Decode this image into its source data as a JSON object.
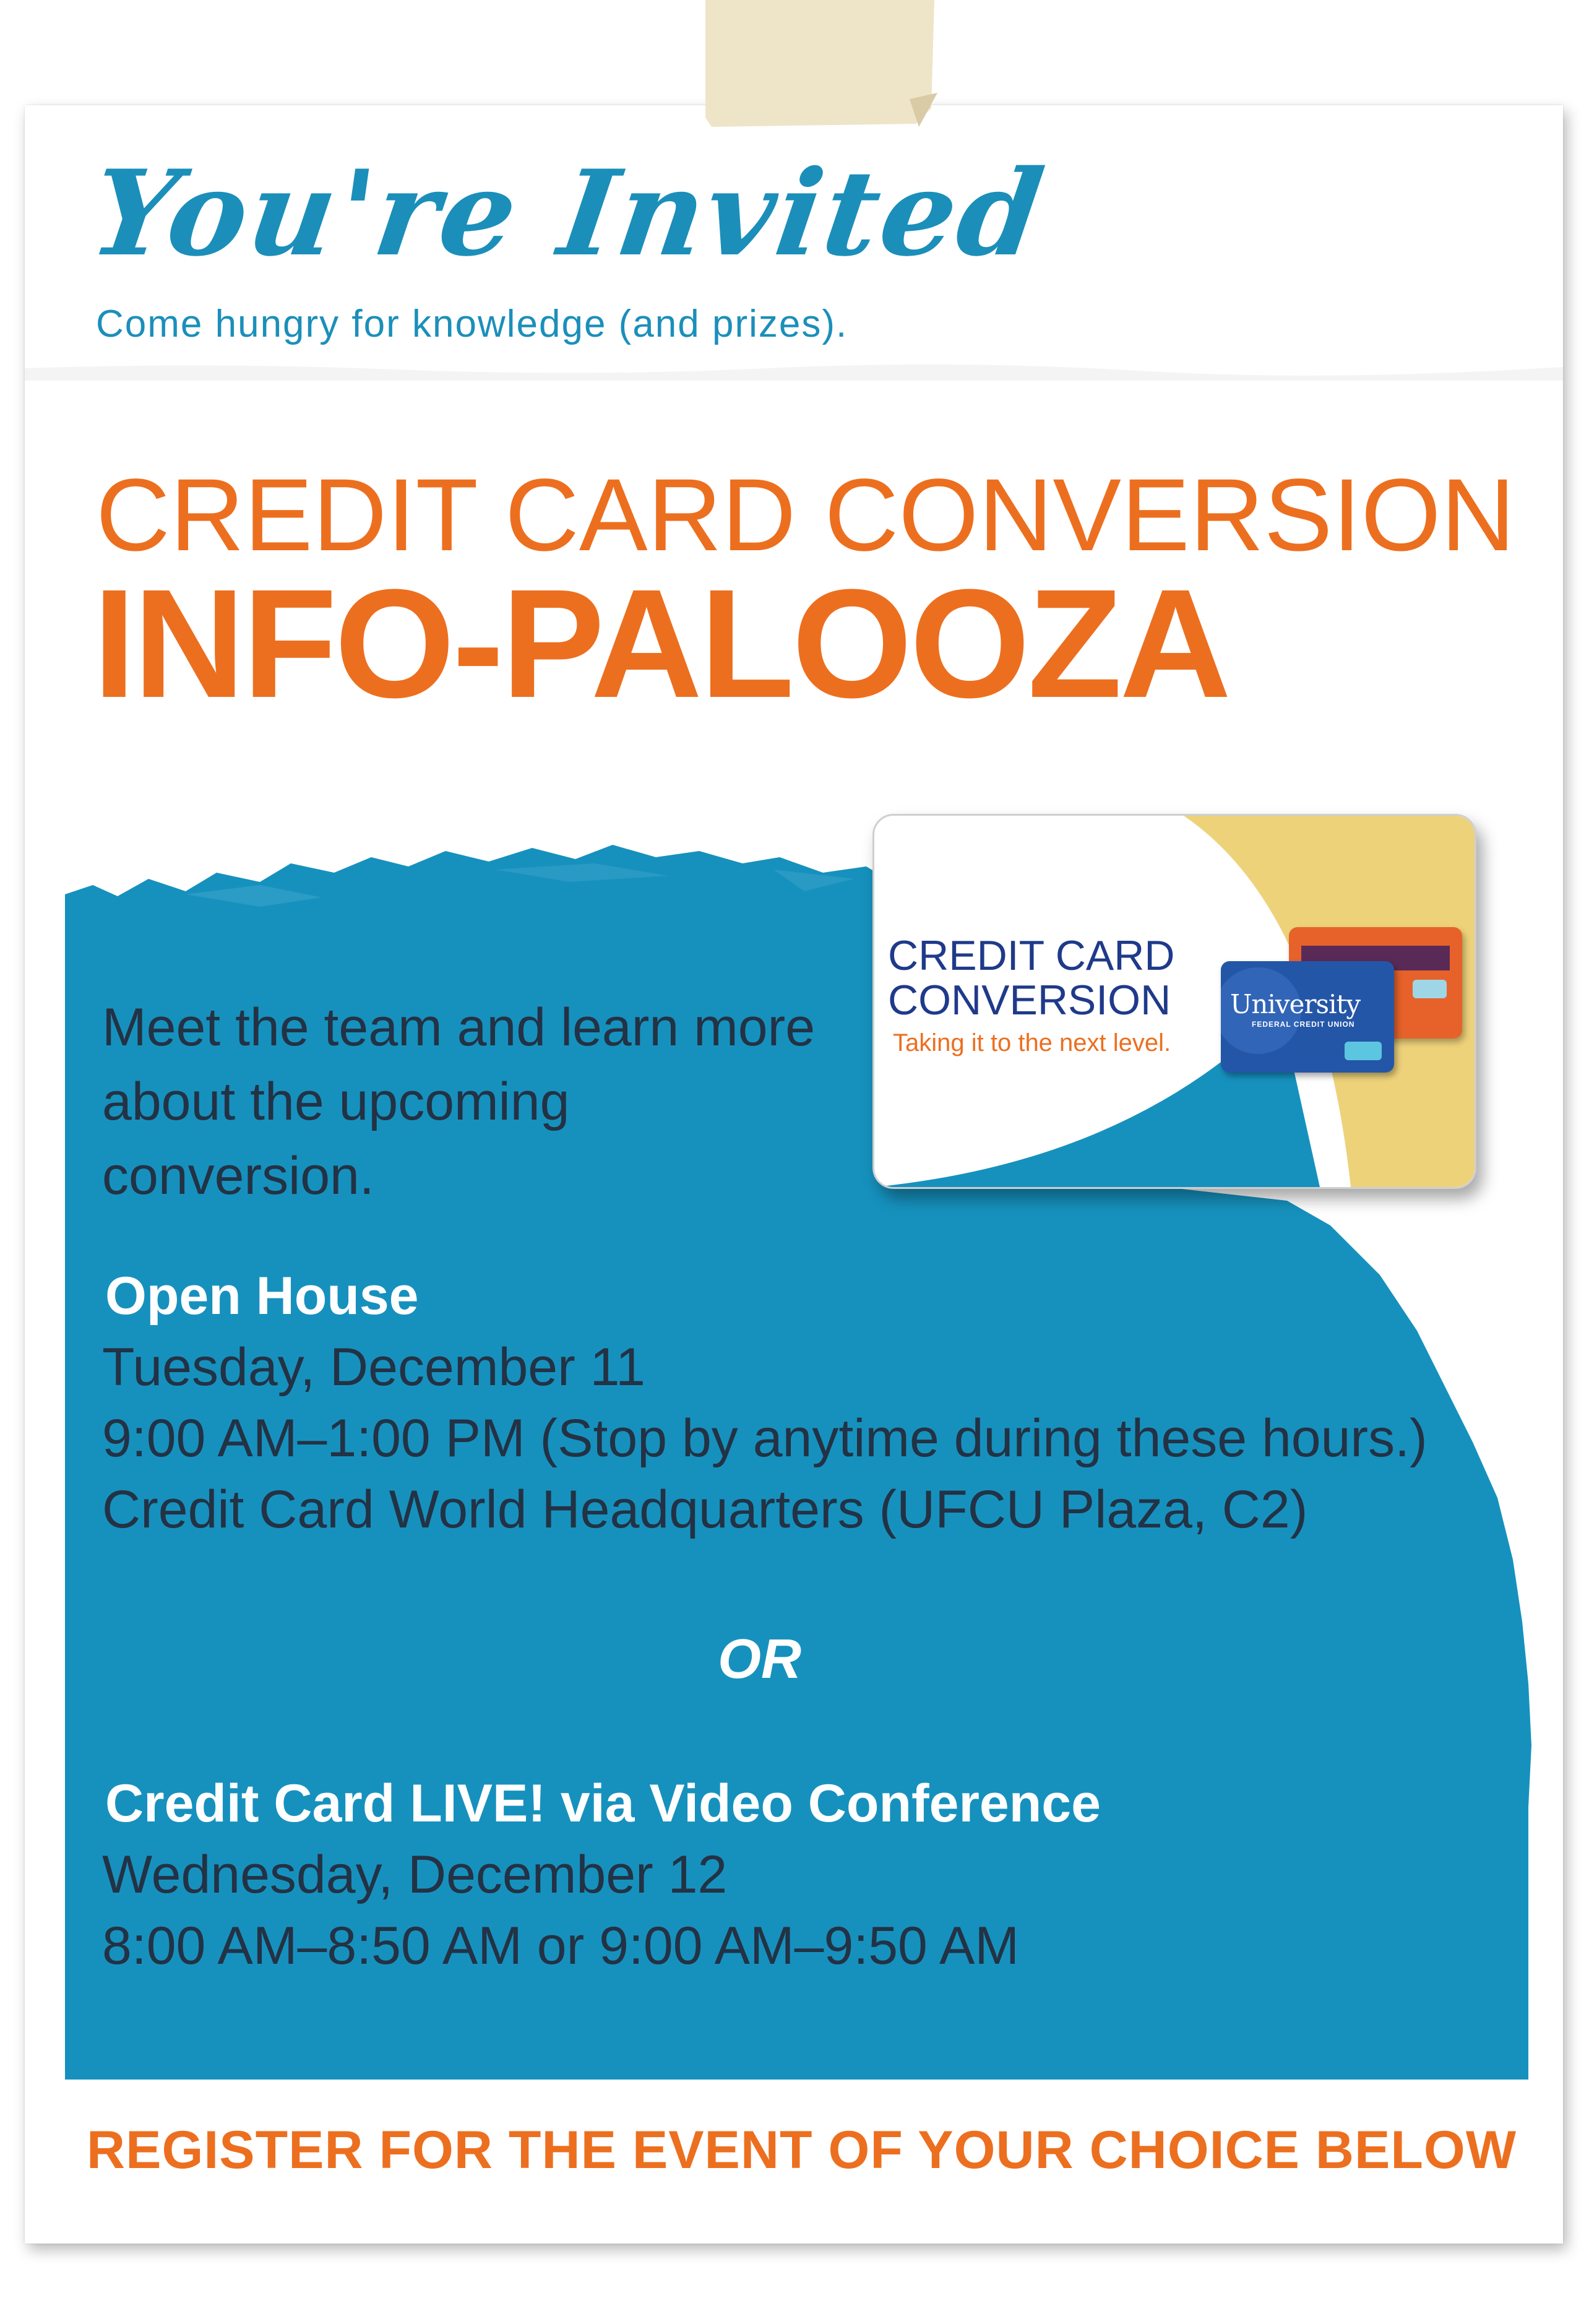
{
  "header": {
    "script_title": "You're Invited",
    "tagline": "Come hungry for knowledge (and prizes)."
  },
  "title": {
    "line1": "CREDIT CARD CONVERSION",
    "line2": "INFO-PALOOZA"
  },
  "intro": "Meet the team and learn more about the upcoming conversion.",
  "card": {
    "line1": "CREDIT CARD",
    "line2": "CONVERSION",
    "subtitle": "Taking it to the next level.",
    "brand": "University",
    "brand_fine": "FEDERAL CREDIT UNION"
  },
  "open_house": {
    "title": "Open House",
    "date": "Tuesday, December 11",
    "time": "9:00 AM–1:00 PM (Stop by anytime during these hours.)",
    "location": "Credit Card World Headquarters (UFCU Plaza, C2)"
  },
  "separator": "OR",
  "video": {
    "title": "Credit Card LIVE! via Video Conference",
    "date": "Wednesday, December 12",
    "time": "8:00 AM–8:50 AM or 9:00 AM–9:50 AM"
  },
  "register": "REGISTER FOR THE EVENT OF YOUR CHOICE BELOW",
  "colors": {
    "orange": "#ec6f1f",
    "blue": "#1b8fba",
    "wave_blue": "#1691be",
    "dark_text": "#233244",
    "card_navy": "#1f3a8a",
    "card_gold": "#eed27a"
  }
}
